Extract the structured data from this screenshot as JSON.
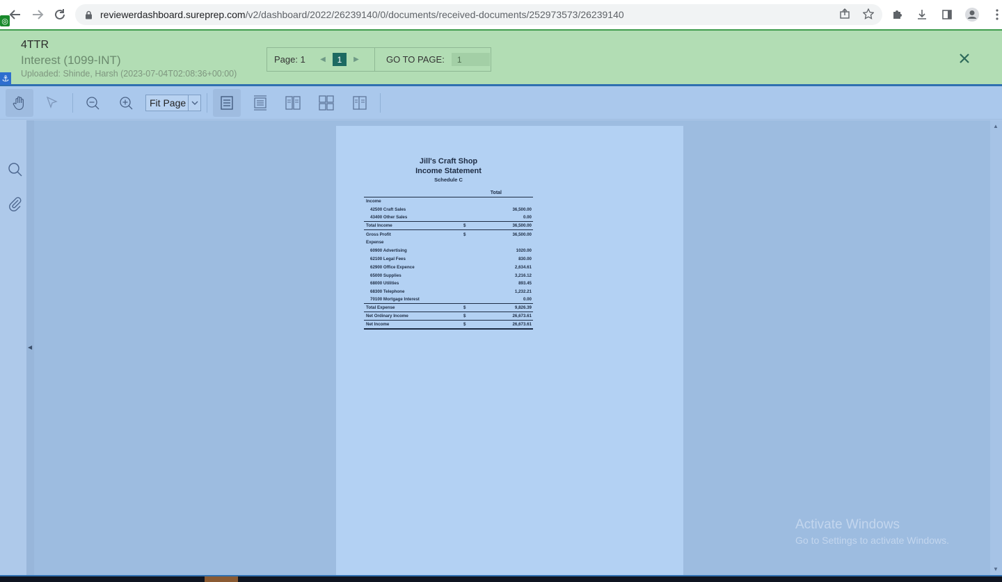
{
  "browser": {
    "url_host": "reviewerdashboard.sureprep.com",
    "url_path": "/v2/dashboard/2022/26239140/0/documents/received-documents/252973573/26239140"
  },
  "document": {
    "code": "4TTR",
    "type": "Interest (1099-INT)",
    "uploaded": "Uploaded: Shinde, Harsh (2023-07-04T02:08:36+00:00)"
  },
  "pager": {
    "page_label": "Page: 1",
    "current_page": "1",
    "goto_label": "GO TO PAGE:",
    "goto_value": "1"
  },
  "toolbar": {
    "zoom_value": "Fit Page"
  },
  "statement": {
    "company": "Jill's Craft Shop",
    "title": "Income Statement",
    "subtitle": "Schedule C",
    "column_header": "Total",
    "rows": [
      {
        "label": "Income",
        "currency": "",
        "amount": ""
      },
      {
        "label": "42500 Craft Sales",
        "currency": "",
        "amount": "36,500.00"
      },
      {
        "label": "43400 Other Sales",
        "currency": "",
        "amount": "0.00"
      },
      {
        "label": "Total Income",
        "currency": "$",
        "amount": "36,500.00"
      },
      {
        "label": "Gross Profit",
        "currency": "$",
        "amount": "36,500.00"
      },
      {
        "label": "Expense",
        "currency": "",
        "amount": ""
      },
      {
        "label": "60900 Advertising",
        "currency": "",
        "amount": "1020.00"
      },
      {
        "label": "62100 Legal Fees",
        "currency": "",
        "amount": "830.00"
      },
      {
        "label": "62900 Office Expence",
        "currency": "",
        "amount": "2,634.61"
      },
      {
        "label": "65000 Supplies",
        "currency": "",
        "amount": "3,216.12"
      },
      {
        "label": "68000 Utilities",
        "currency": "",
        "amount": "893.45"
      },
      {
        "label": "68300 Telephone",
        "currency": "",
        "amount": "1,232.21"
      },
      {
        "label": "70100 Mortgage Interest",
        "currency": "",
        "amount": "0.00"
      },
      {
        "label": "Total Expense",
        "currency": "$",
        "amount": "9,826.39"
      },
      {
        "label": "Net Ordinary Income",
        "currency": "$",
        "amount": "26,673.61"
      },
      {
        "label": "Net Income",
        "currency": "$",
        "amount": "26,673.61"
      }
    ]
  },
  "watermark": {
    "line1": "Activate Windows",
    "line2": "Go to Settings to activate Windows."
  },
  "colors": {
    "header_green": "#b2ddb4",
    "accent_teal": "#1d6a62",
    "viewer_blue": "#9dbce0",
    "page_blue": "#b3d1f3"
  }
}
